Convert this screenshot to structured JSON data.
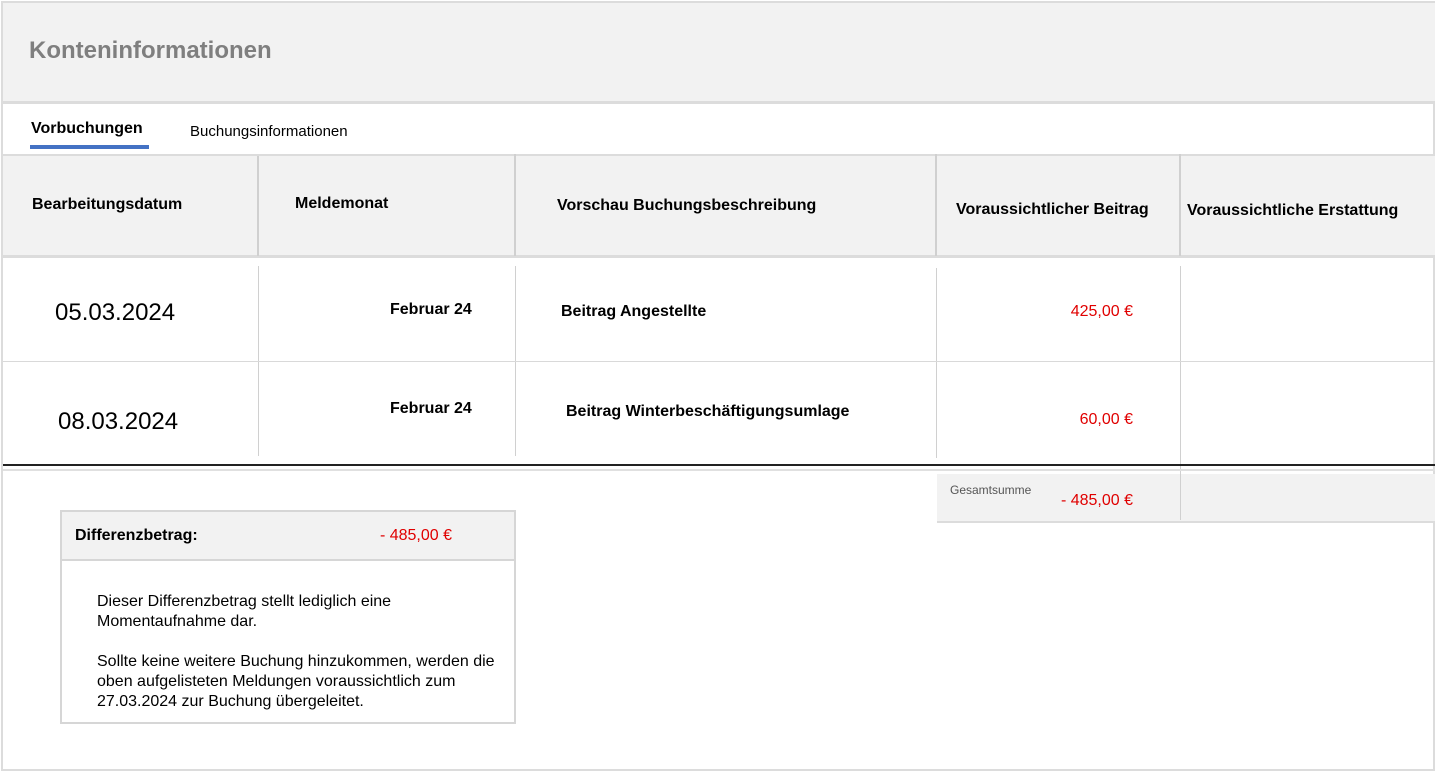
{
  "header": {
    "title": "Konteninformationen"
  },
  "tabs": [
    {
      "label": "Vorbuchungen",
      "active": true
    },
    {
      "label": "Buchungsinformationen",
      "active": false
    }
  ],
  "table": {
    "columns": [
      "Bearbeitungsdatum",
      "Meldemonat",
      "Vorschau Buchungsbeschreibung",
      "Voraussichtlicher Beitrag",
      "Voraussichtliche Erstattung"
    ],
    "rows": [
      {
        "date": "05.03.2024",
        "month": "Februar 24",
        "description": "Beitrag Angestellte",
        "contribution": "425,00 €",
        "refund": ""
      },
      {
        "date": "08.03.2024",
        "month": "Februar 24",
        "description": "Beitrag Winterbeschäftigungsumlage",
        "contribution": "60,00 €",
        "refund": ""
      }
    ],
    "total": {
      "label": "Gesamtsumme",
      "value": "- 485,00 €"
    }
  },
  "difference": {
    "label": "Differenzbetrag:",
    "value": "- 485,00 €",
    "paragraph1": "Dieser Differenzbetrag stellt lediglich eine Momentaufnahme dar.",
    "paragraph2": "Sollte keine weitere Buchung hinzukommen, werden die oben aufgelisteten Meldungen voraussichtlich zum 27.03.2024 zur Buchung übergeleitet."
  },
  "colors": {
    "accent": "#4472c4",
    "negative": "#e00000",
    "panel": "#f2f2f2"
  }
}
